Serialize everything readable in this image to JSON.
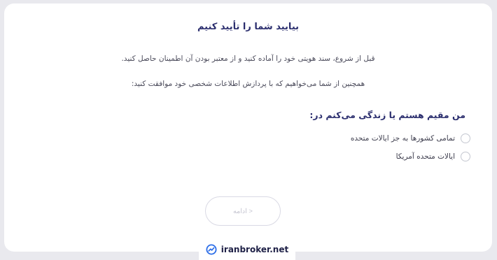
{
  "verification": {
    "title": "بیایید شما را تأیید کنیم",
    "intro_text": "قبل از شروع، سند هویتی خود را آماده کنید و از معتبر بودن آن اطمینان حاصل کنید.",
    "consent_text": "همچنین از شما می‌خواهیم که با پردازش اطلاعات شخصی خود موافقت کنید:",
    "residence_question": "من مقیم هستم یا زندگی می‌کنم در:",
    "options": [
      {
        "label": "تمامی کشورها به جز ایالات متحده",
        "selected": false
      },
      {
        "label": "ایالات متحده آمریکا",
        "selected": false
      }
    ],
    "continue_label": "ادامه >",
    "continue_enabled": false
  },
  "branding": {
    "site": "iranbroker.net",
    "logo_icon": "chart-trend-icon",
    "logo_color": "#2b6de8"
  }
}
